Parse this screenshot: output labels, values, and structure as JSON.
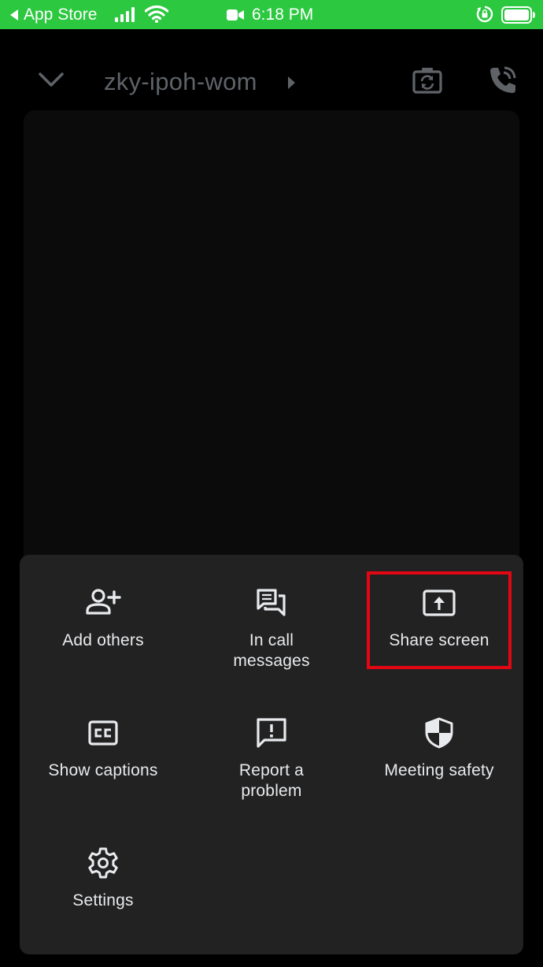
{
  "status_bar": {
    "back_app": "App Store",
    "time": "6:18 PM",
    "bar_color": "#2bc840"
  },
  "call_header": {
    "title": "zky-ipoh-wom",
    "title_color": "#5f6368"
  },
  "menu": {
    "items": [
      {
        "icon": "add-person-icon",
        "label": "Add others"
      },
      {
        "icon": "chat-bubbles-icon",
        "label_lines": [
          "In call",
          "messages"
        ]
      },
      {
        "icon": "share-screen-icon",
        "label": "Share screen"
      },
      {
        "icon": "closed-captions-icon",
        "label": "Show captions"
      },
      {
        "icon": "report-feedback-icon",
        "label_lines": [
          "Report a",
          "problem"
        ]
      },
      {
        "icon": "shield-icon",
        "label": "Meeting safety"
      },
      {
        "icon": "gear-icon",
        "label": "Settings"
      }
    ],
    "highlight_color": "#e30613",
    "sheet_color": "#222222"
  }
}
